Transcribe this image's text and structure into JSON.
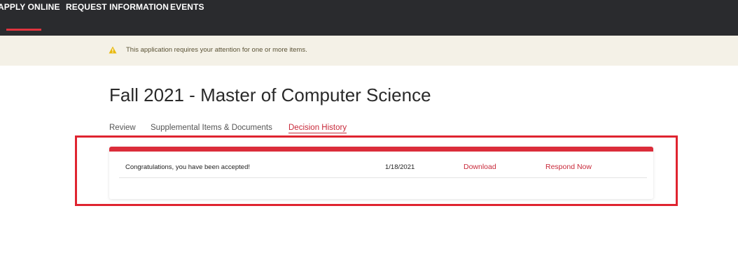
{
  "nav": {
    "items": [
      {
        "label": "APPLY ONLINE"
      },
      {
        "label": "REQUEST INFORMATION"
      },
      {
        "label": "EVENTS"
      }
    ]
  },
  "banner": {
    "icon": "warning-icon",
    "text": "This application requires your attention for one or more items."
  },
  "page": {
    "title": "Fall 2021 - Master of Computer Science"
  },
  "tabs": [
    {
      "label": "Review"
    },
    {
      "label": "Supplemental Items & Documents"
    },
    {
      "label": "Decision History",
      "active": true
    }
  ],
  "decisions": [
    {
      "message": "Congratulations, you have been accepted!",
      "date": "1/18/2021",
      "download_label": "Download",
      "respond_label": "Respond Now"
    }
  ],
  "colors": {
    "nav_bg": "#2a2b2e",
    "accent": "#db2d3a",
    "banner_bg": "#f4f1e7",
    "link": "#c8293a",
    "highlight": "#df2430"
  }
}
